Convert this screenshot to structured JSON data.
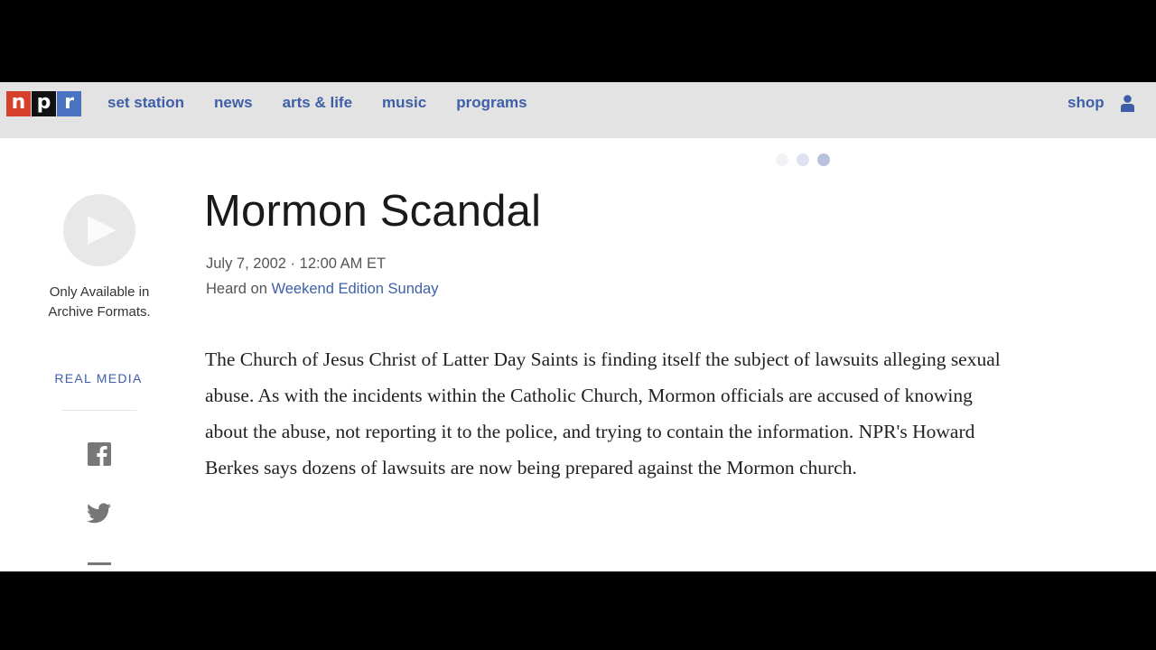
{
  "header": {
    "logo_letters": [
      "n",
      "p",
      "r"
    ],
    "logo_colors": [
      "#d6412b",
      "#111111",
      "#4a73c2"
    ],
    "nav": [
      "set station",
      "news",
      "arts & life",
      "music",
      "programs"
    ],
    "shop_label": "shop",
    "user_icon": "user-icon",
    "accent_color": "#3e5fa8"
  },
  "sidebar": {
    "play_icon": "play-icon",
    "archive_note": "Only Available in Archive Formats.",
    "real_media_label": "REAL MEDIA",
    "share_icons": [
      "facebook-icon",
      "twitter-icon",
      "more-icon"
    ]
  },
  "story": {
    "title": "Mormon Scandal",
    "dateline": "July 7, 2002 · 12:00 AM ET",
    "heard_on_prefix": "Heard on",
    "program_link": "Weekend Edition Sunday",
    "summary": "The Church of Jesus Christ of Latter Day Saints is finding itself the subject of lawsuits alleging sexual abuse. As with the incidents within the Catholic Church, Mormon officials are accused of knowing about the abuse, not reporting it to the police, and trying to contain the information. NPR's Howard Berkes says dozens of lawsuits are now being prepared against the Mormon church."
  }
}
